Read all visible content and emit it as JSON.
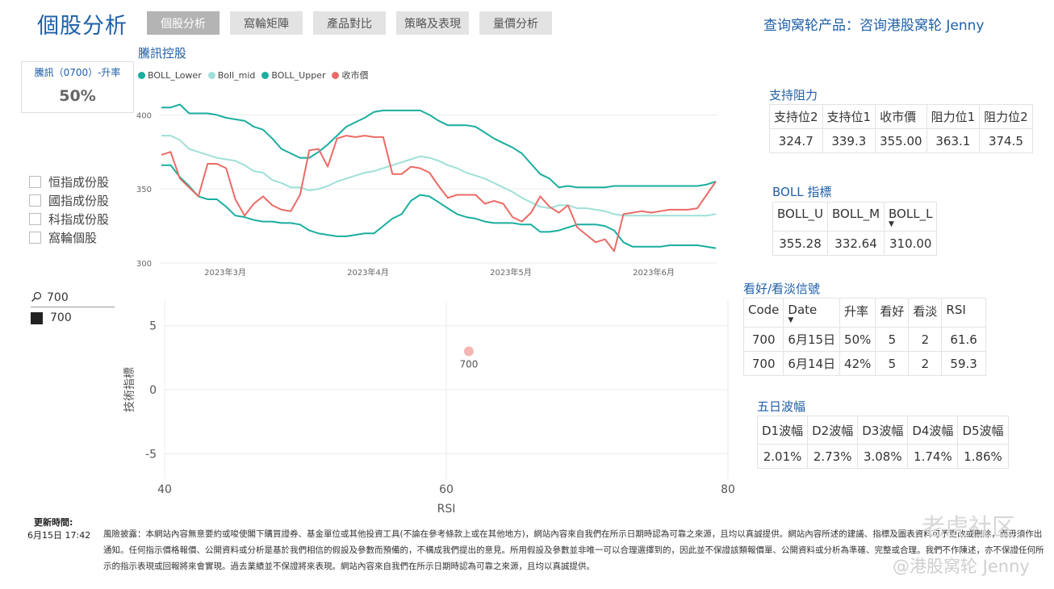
{
  "header": {
    "title": "個股分析",
    "tabs": [
      "個股分析",
      "窩輪矩陣",
      "產品對比",
      "策略及表現",
      "量價分析"
    ],
    "right_text": "查询窝轮产品：咨询港股窝轮 Jenny"
  },
  "card": {
    "label": "騰訊（0700）-升率",
    "value": "50%"
  },
  "filters": {
    "items": [
      "恒指成份股",
      "國指成份股",
      "科指成份股",
      "窩輪個股"
    ]
  },
  "search": {
    "value": "700",
    "result": "700"
  },
  "support_resistance": {
    "title": "支持阻力",
    "headers": [
      "支持位2",
      "支持位1",
      "收市價",
      "阻力位1",
      "阻力位2"
    ],
    "values": [
      "324.7",
      "339.3",
      "355.00",
      "363.1",
      "374.5"
    ]
  },
  "boll": {
    "title": "BOLL 指標",
    "headers": [
      "BOLL_U",
      "BOLL_M",
      "BOLL_L"
    ],
    "values": [
      "355.28",
      "332.64",
      "310.00"
    ]
  },
  "signals": {
    "title": "看好/看淡信號",
    "headers": [
      "Code",
      "Date",
      "升率",
      "看好",
      "看淡",
      "RSI"
    ],
    "rows": [
      [
        "700",
        "6月15日",
        "50%",
        "5",
        "2",
        "61.6"
      ],
      [
        "700",
        "6月14日",
        "42%",
        "5",
        "2",
        "59.3"
      ]
    ]
  },
  "volatility": {
    "title": "五日波幅",
    "headers": [
      "D1波幅",
      "D2波幅",
      "D3波幅",
      "D4波幅",
      "D5波幅"
    ],
    "values": [
      "2.01%",
      "2.73%",
      "3.08%",
      "1.74%",
      "1.86%"
    ]
  },
  "update": {
    "label": "更新時間:",
    "value": "6月15日 17:42"
  },
  "disclaimer": "風險披露：本網站內容無意要約或唆使閣下購買證券、基金單位或其他投資工具(不論在參考條款上或在其他地方)，網站內容來自我們在所示日期時認為可靠之來源，且均以真誠提供。網站內容所述的建議、指標及圖表資料可予更改或刪除，而毋須作出通知。任何指示價格報價、公開資料或分析是基於我們相信的假設及參數而預備的，不構成我們提出的意見。所用假設及參數並非唯一可以合理選擇到的，因此並不保證該類報價單、公開資料或分析為準確、完整或合理。我們不作陳述，亦不保證任何所示的指示表現或回報將來會實現。過去業績並不保證將來表現。網站內容來自我們在所示日期時認為可靠之來源，且均以真誠提供。",
  "watermark": {
    "line1": "老虎社区",
    "line2": "@港股窝轮 Jenny"
  },
  "chart_data": [
    {
      "type": "line",
      "title": "騰訊控股",
      "legend": "top-left",
      "ylim": [
        300,
        410
      ],
      "yticks": [
        300,
        350,
        400
      ],
      "xticks": [
        "2023年3月",
        "2023年4月",
        "2023年5月",
        "2023年6月"
      ],
      "colors": {
        "BOLL_Lower": "#1aae9f",
        "Boll_mid": "#9fe0d9",
        "BOLL_Upper": "#1aae9f",
        "收市價": "#ea6b66"
      },
      "series": [
        {
          "name": "BOLL_Lower",
          "values": [
            366,
            366,
            358,
            352,
            345,
            343,
            343,
            338,
            332,
            331,
            329,
            328,
            328,
            327,
            327,
            326,
            322,
            320,
            319,
            318,
            318,
            319,
            320,
            320,
            325,
            330,
            333,
            342,
            346,
            345,
            341,
            337,
            333,
            331,
            330,
            328,
            327,
            327,
            327,
            326,
            326,
            321,
            321,
            322,
            324,
            326,
            326,
            326,
            325,
            322,
            314,
            311,
            311,
            311,
            311,
            312,
            312,
            312,
            312,
            311,
            310
          ]
        },
        {
          "name": "Boll_mid",
          "values": [
            386,
            386,
            383,
            377,
            375,
            373,
            371,
            370,
            369,
            366,
            362,
            361,
            356,
            354,
            351,
            351,
            349,
            350,
            352,
            355,
            357,
            359,
            361,
            362,
            364,
            366,
            368,
            370,
            372,
            371,
            369,
            366,
            364,
            361,
            359,
            357,
            354,
            351,
            348,
            344,
            341,
            338,
            337,
            339,
            339,
            337,
            337,
            336,
            335,
            333,
            332,
            332,
            332,
            332,
            332,
            332,
            332,
            332,
            332,
            332,
            333
          ]
        },
        {
          "name": "BOLL_Upper",
          "values": [
            405,
            405,
            407,
            401,
            401,
            401,
            400,
            398,
            397,
            396,
            392,
            390,
            384,
            377,
            374,
            371,
            371,
            375,
            380,
            386,
            392,
            395,
            398,
            402,
            403,
            403,
            403,
            403,
            403,
            400,
            396,
            393,
            393,
            393,
            392,
            388,
            384,
            381,
            378,
            374,
            367,
            360,
            357,
            351,
            352,
            351,
            351,
            351,
            351,
            352,
            352,
            352,
            352,
            352,
            352,
            352,
            352,
            352,
            352,
            353,
            355
          ]
        },
        {
          "name": "收市價",
          "values": [
            373,
            375,
            357,
            351,
            345,
            367,
            367,
            364,
            343,
            332,
            340,
            345,
            339,
            336,
            335,
            346,
            376,
            377,
            365,
            384,
            386,
            385,
            386,
            385,
            385,
            360,
            360,
            365,
            364,
            361,
            352,
            344,
            346,
            346,
            346,
            340,
            342,
            340,
            331,
            328,
            334,
            345,
            338,
            334,
            339,
            324,
            319,
            314,
            316,
            308,
            333,
            334,
            335,
            334,
            335,
            336,
            336,
            336,
            337,
            346,
            355
          ]
        }
      ]
    },
    {
      "type": "scatter",
      "xlabel": "RSI",
      "ylabel": "技術指標",
      "xlim": [
        40,
        80
      ],
      "ylim": [
        -7,
        7
      ],
      "xticks": [
        40,
        60,
        80
      ],
      "yticks": [
        -5,
        0,
        5
      ],
      "points": [
        {
          "x": 61.6,
          "y": 3,
          "label": "700"
        }
      ]
    }
  ]
}
